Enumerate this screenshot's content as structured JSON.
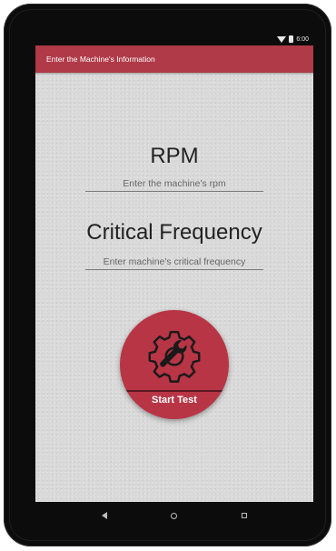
{
  "status_bar": {
    "time": "6:00"
  },
  "app_bar": {
    "title": "Enter the Machine's Information"
  },
  "form": {
    "rpm_title": "RPM",
    "rpm_placeholder": "Enter the machine's rpm",
    "rpm_value": "",
    "freq_title": "Critical Frequency",
    "freq_placeholder": "Enter machine's critical frequency",
    "freq_value": ""
  },
  "start_button": {
    "label": "Start Test",
    "icon": "gear-wrench-icon"
  },
  "colors": {
    "accent": "#b03a48",
    "button": "#b83545",
    "screen_bg": "#d9d9d9"
  },
  "nav": {
    "back_icon": "back-icon",
    "home_icon": "home-icon",
    "recents_icon": "recents-icon"
  }
}
